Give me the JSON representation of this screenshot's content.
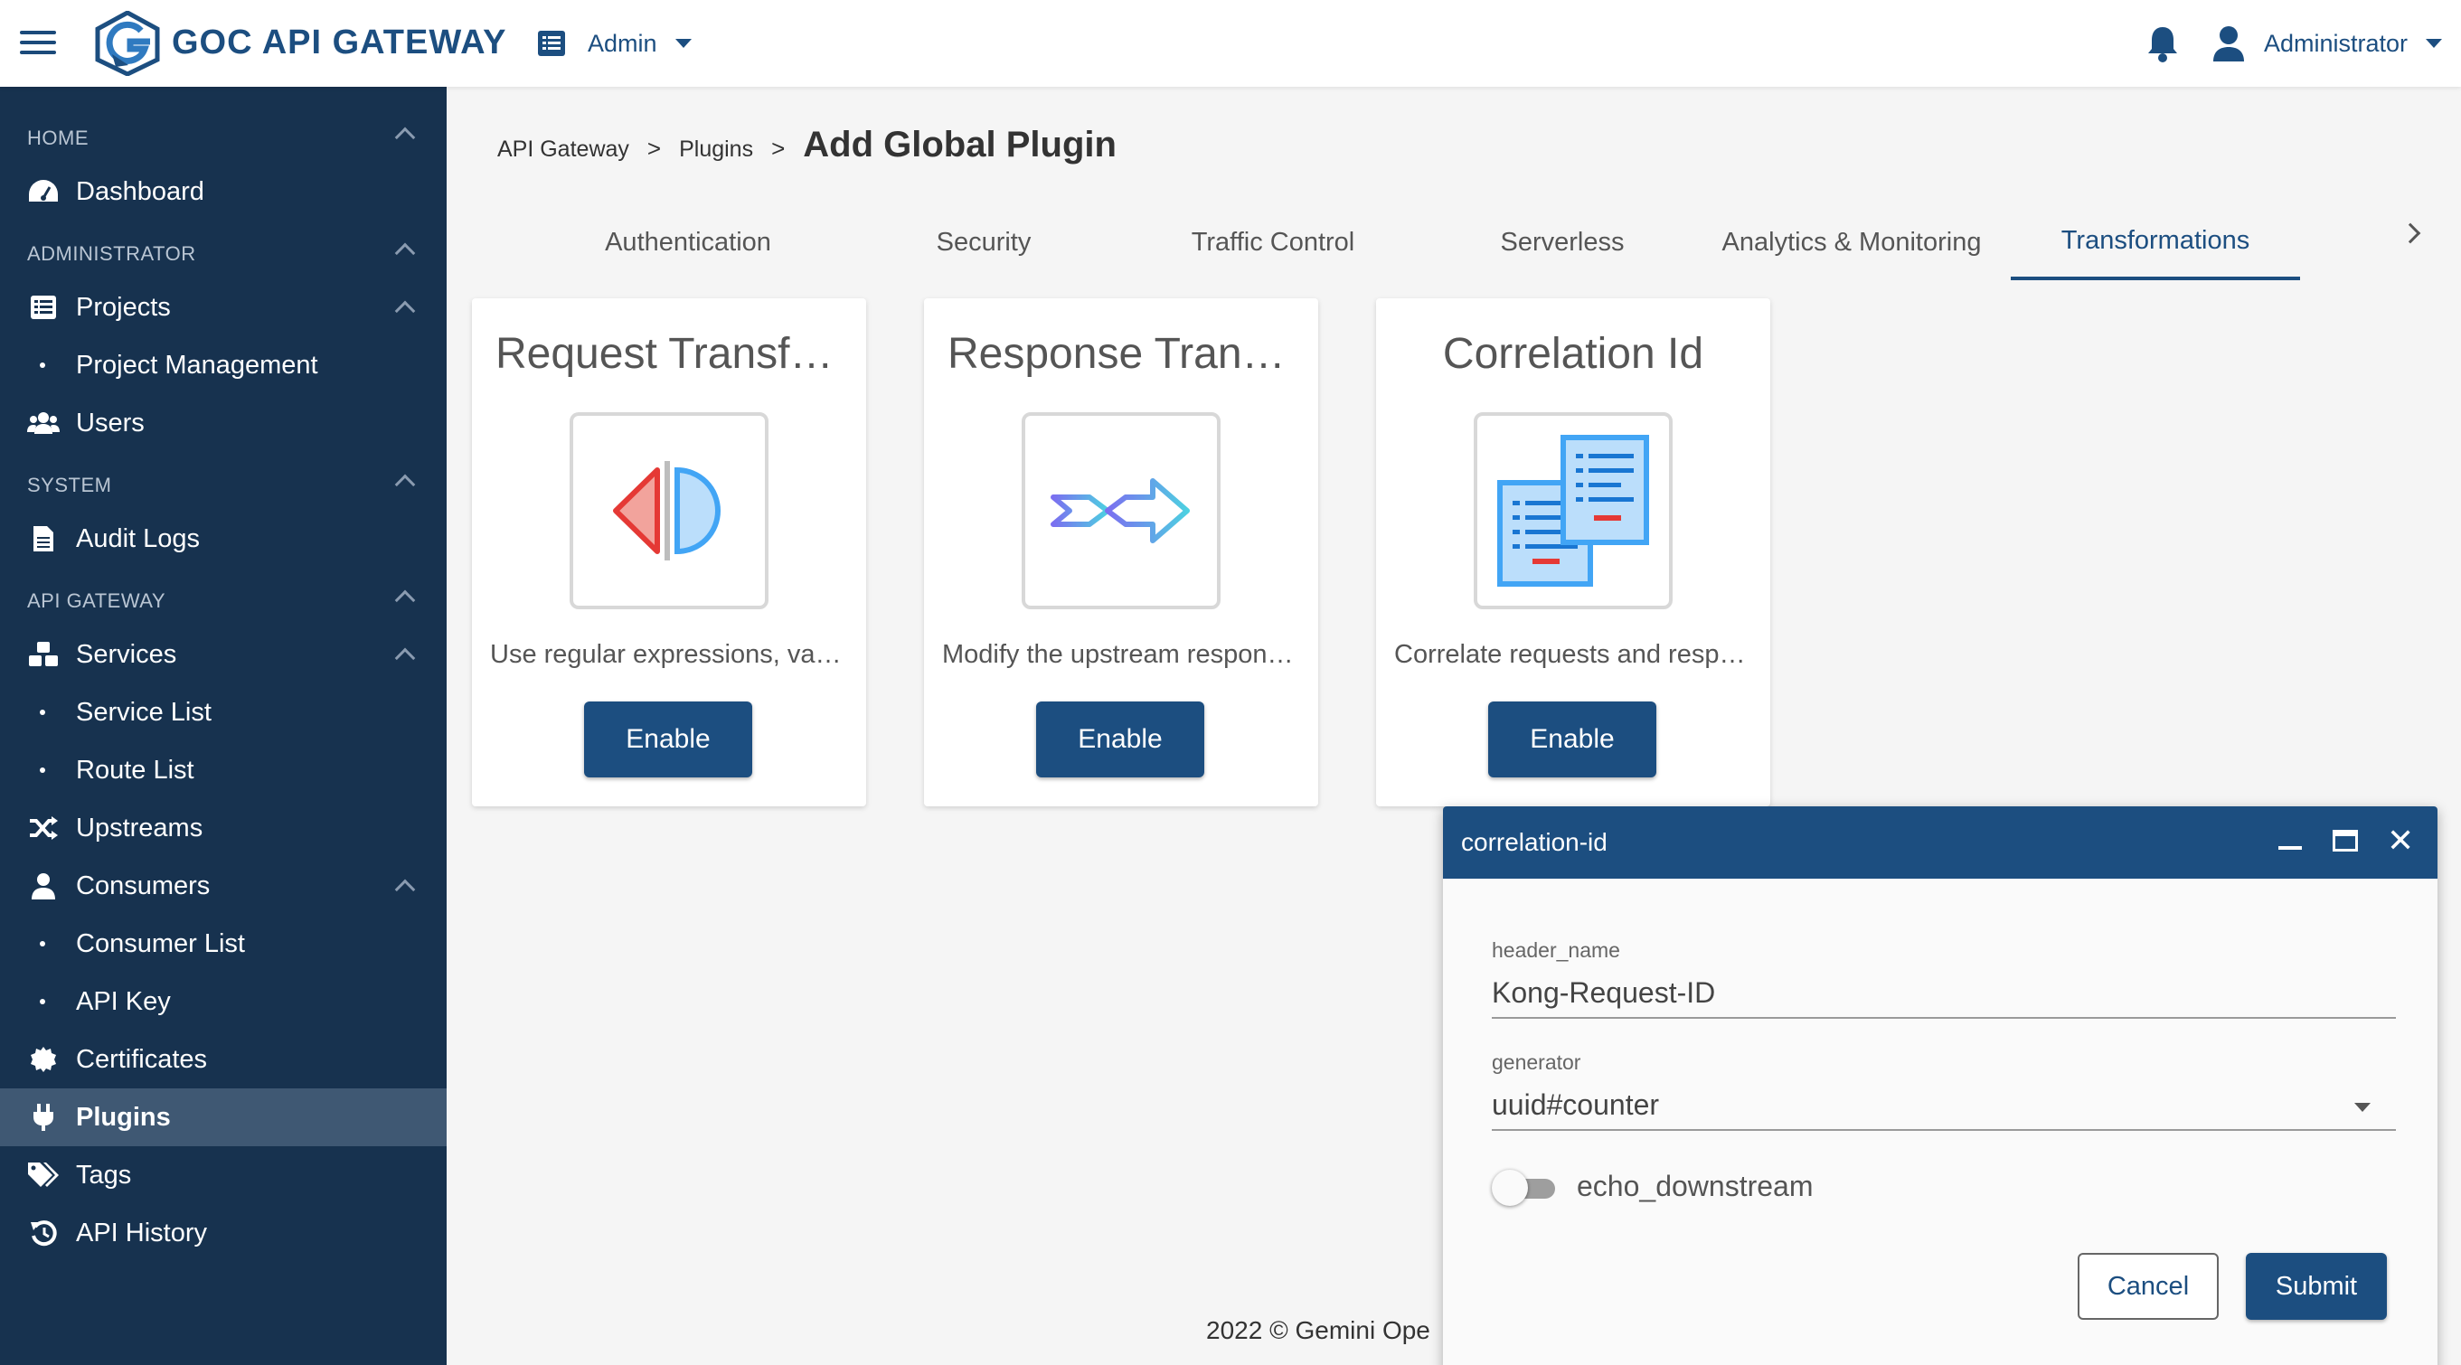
{
  "header": {
    "brand": "GOC API GATEWAY",
    "admin_menu_label": "Admin",
    "user_menu_label": "Administrator",
    "icons": [
      "hamburger-icon",
      "logo-icon",
      "list-icon",
      "bell-icon",
      "user-icon"
    ]
  },
  "sidebar": {
    "sections": {
      "home": "HOME",
      "administrator": "ADMINISTRATOR",
      "system": "SYSTEM",
      "api_gateway": "API GATEWAY"
    },
    "items": {
      "dashboard": "Dashboard",
      "projects": "Projects",
      "project_management": "Project Management",
      "users": "Users",
      "audit_logs": "Audit Logs",
      "services": "Services",
      "service_list": "Service List",
      "route_list": "Route List",
      "upstreams": "Upstreams",
      "consumers": "Consumers",
      "consumer_list": "Consumer List",
      "api_key": "API Key",
      "certificates": "Certificates",
      "plugins": "Plugins",
      "tags": "Tags",
      "api_history": "API History"
    },
    "active_item": "Plugins"
  },
  "breadcrumb": {
    "items": [
      "API Gateway",
      "Plugins"
    ],
    "separator": ">",
    "current": "Add Global Plugin"
  },
  "tabs": [
    {
      "label": "Authentication"
    },
    {
      "label": "Security"
    },
    {
      "label": "Traffic Control"
    },
    {
      "label": "Serverless"
    },
    {
      "label": "Analytics & Monitoring"
    },
    {
      "label": "Transformations"
    }
  ],
  "active_tab": "Transformations",
  "cards": [
    {
      "title": "Request Transformer",
      "description": "Use regular expressions, variables and templates to transform the request",
      "button": "Enable",
      "icon": "request-transformer-icon"
    },
    {
      "title": "Response Transformer",
      "description": "Modify the upstream response headers and body",
      "button": "Enable",
      "icon": "response-transformer-icon"
    },
    {
      "title": "Correlation Id",
      "description": "Correlate requests and responses using a unique ID",
      "button": "Enable",
      "icon": "correlation-id-icon"
    }
  ],
  "footer": {
    "text": "2022 © Gemini Ope"
  },
  "dialog": {
    "title": "correlation-id",
    "fields": {
      "header_name_label": "header_name",
      "header_name_value": "Kong-Request-ID",
      "generator_label": "generator",
      "generator_value": "uuid#counter",
      "echo_downstream_label": "echo_downstream",
      "echo_downstream_on": false
    },
    "cancel_label": "Cancel",
    "submit_label": "Submit"
  },
  "colors": {
    "primary": "#1c4e80",
    "sidebar_bg": "#17324f",
    "sidebar_active": "#3f5873"
  }
}
